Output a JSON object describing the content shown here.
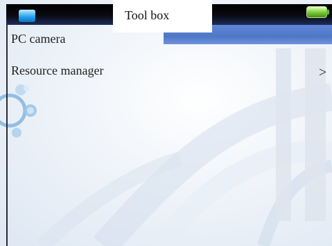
{
  "header": {
    "title": "Tool box"
  },
  "menu": {
    "items": [
      {
        "label": "PC camera"
      },
      {
        "label": "Resource manager",
        "chevron": ">"
      }
    ]
  },
  "status": {
    "battery_color": "#7fce3a",
    "indicator_color": "#2aa6ef"
  },
  "icons": {
    "status_indicator": "status-indicator-icon",
    "battery": "battery-icon",
    "chevron": "chevron-right-icon"
  }
}
